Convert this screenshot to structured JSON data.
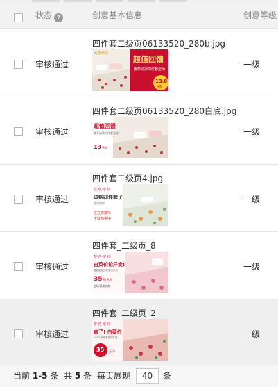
{
  "header": {
    "status_label": "状态",
    "info_label": "创意基本信息",
    "level_label": "创意等级"
  },
  "rows": [
    {
      "name": "四件套二级页06133520_280b.jpg",
      "status": "审核通过",
      "level": "一级",
      "thumb": {
        "badge": "九牧家纺",
        "headline": "超值回馈",
        "sub": "夏季清凉四件套全场",
        "price": "13.8",
        "price_unit": "元起"
      }
    },
    {
      "name": "四件套二级页06133520_280白底.jpg",
      "status": "审核通过",
      "level": "一级",
      "thumb": {
        "headline": "超值回馈",
        "sub": "夏季清凉四件套全场",
        "price": "13",
        "price_unit": "元起"
      }
    },
    {
      "name": "四件套二级页4.jpg",
      "status": "审核通过",
      "level": "一级",
      "thumb": {
        "logo": "梦·色·家·纺",
        "headline": "该购四件套了",
        "sub": "全场包邮",
        "line2": "还在犹豫吗",
        "line3": "千款热卖中"
      }
    },
    {
      "name": "四件套_二级页_8",
      "status": "审核通过",
      "level": "一级",
      "thumb": {
        "logo": "梦·色·家·纺",
        "headline": "白菜价论斤卖!",
        "sub": "春夏新品四件套论斤卖",
        "price": "35",
        "price_unit": "元/斤起",
        "tag": "全场满减包邮"
      }
    },
    {
      "name": "四件套_二级页_2",
      "status": "审核通过",
      "level": "一级",
      "thumb": {
        "logo": "梦·色·家·纺",
        "headline": "疯了! 白菜价",
        "sub": "100%全棉春夏四件套",
        "price": "35",
        "price_unit": "元/斤"
      }
    }
  ],
  "footer": {
    "current_label": "当前",
    "range": "1-5",
    "unit": "条",
    "total_label": "共",
    "total": "5",
    "total_unit": "条",
    "perpage_label": "每页展现",
    "perpage_value": "40",
    "perpage_unit": "条"
  }
}
